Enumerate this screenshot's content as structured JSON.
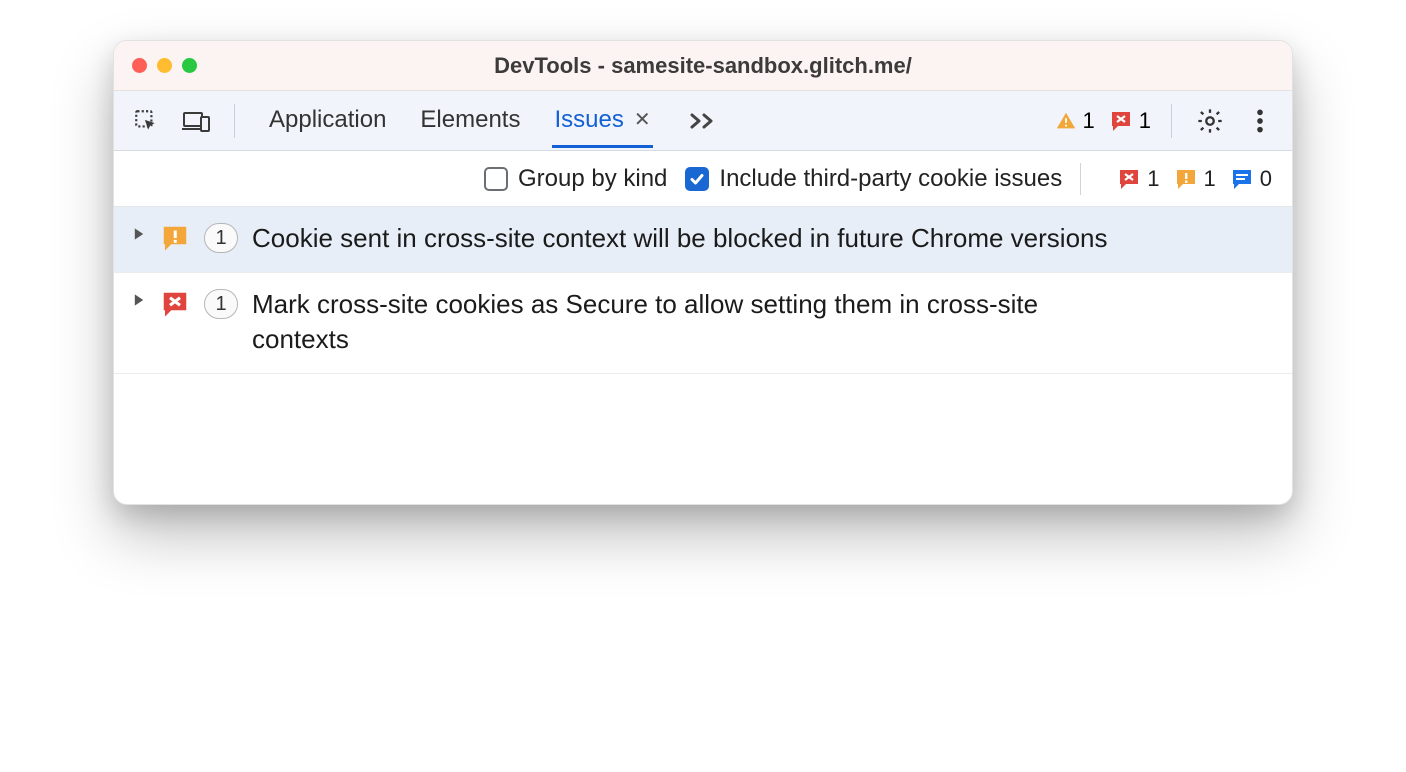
{
  "window": {
    "title": "DevTools - samesite-sandbox.glitch.me/"
  },
  "tabs": {
    "items": [
      {
        "label": "Application",
        "active": false
      },
      {
        "label": "Elements",
        "active": false
      },
      {
        "label": "Issues",
        "active": true
      }
    ]
  },
  "toolbar_badges": {
    "warning_count": "1",
    "error_count": "1"
  },
  "filters": {
    "group_by_kind": {
      "label": "Group by kind",
      "checked": false
    },
    "include_third_party": {
      "label": "Include third-party cookie issues",
      "checked": true
    }
  },
  "issue_counters": {
    "error": "1",
    "warning": "1",
    "info": "0"
  },
  "issues": [
    {
      "severity": "warning",
      "count": "1",
      "title": "Cookie sent in cross-site context will be blocked in future Chrome versions",
      "selected": true
    },
    {
      "severity": "error",
      "count": "1",
      "title": "Mark cross-site cookies as Secure to allow setting them in cross-site contexts",
      "selected": false
    }
  ],
  "colors": {
    "accent": "#1967d2",
    "warning": "#f3a73a",
    "error": "#e0453d",
    "info": "#1a73e8"
  }
}
